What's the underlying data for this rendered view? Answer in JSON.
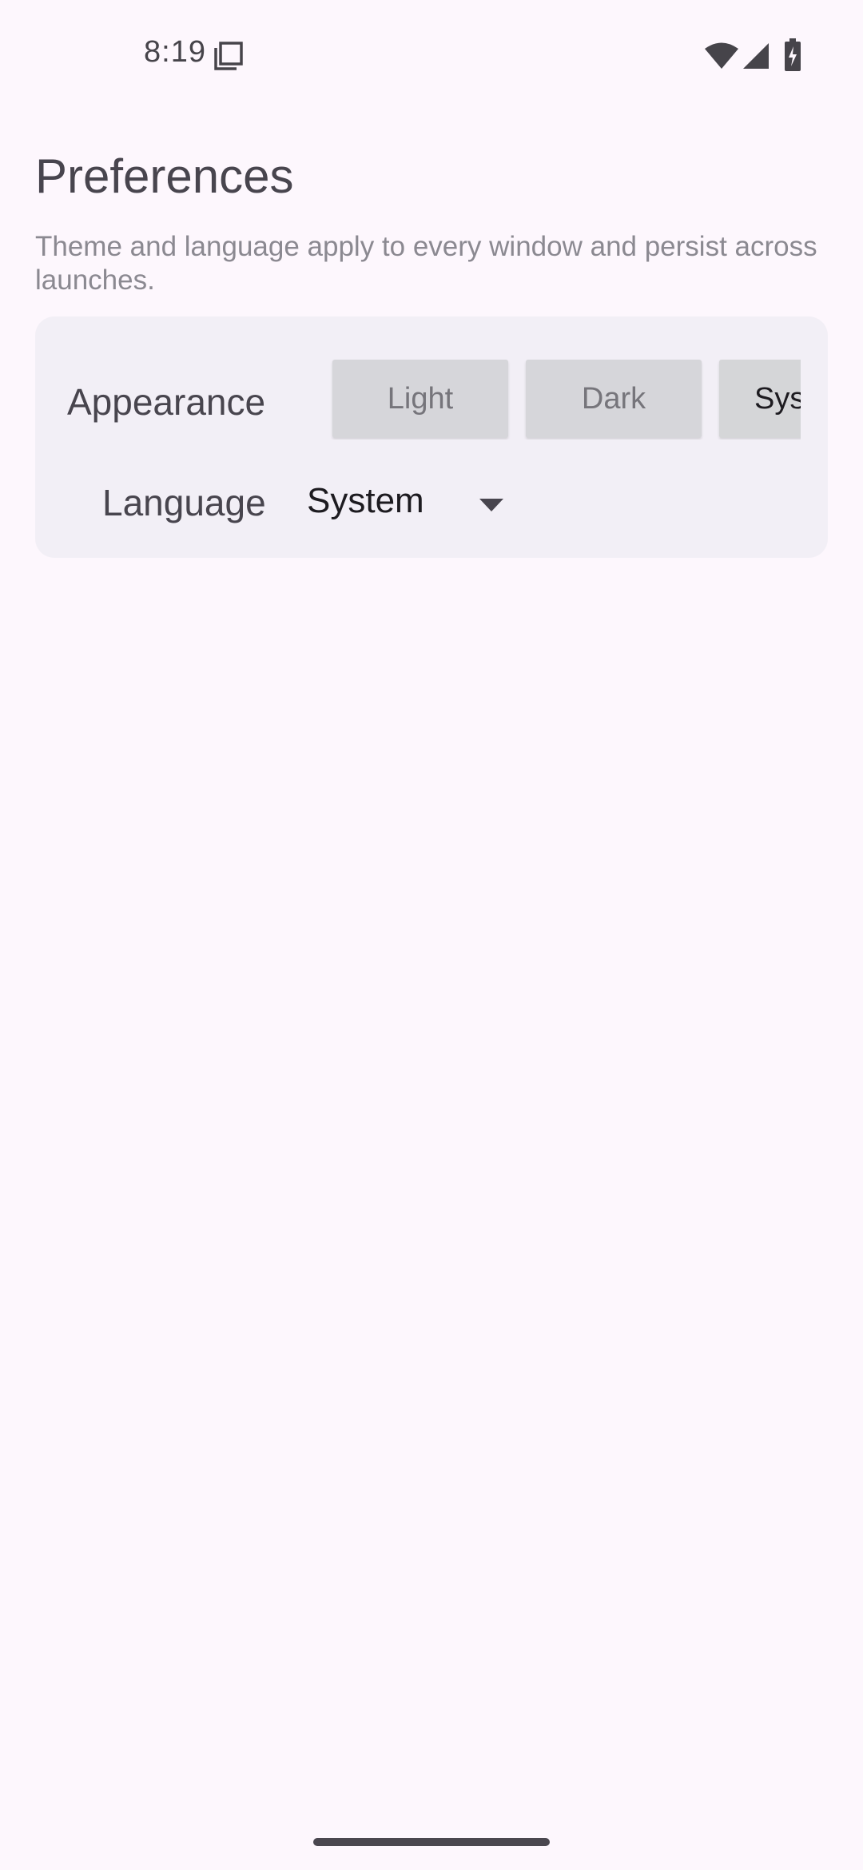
{
  "status_bar": {
    "time": "8:19",
    "icons": [
      "notification-icon",
      "wifi-icon",
      "signal-icon",
      "battery-charging-icon"
    ]
  },
  "header": {
    "title": "Preferences",
    "subtitle": "Theme and language apply to every window and persist across launches."
  },
  "appearance": {
    "label": "Appearance",
    "options": [
      "Light",
      "Dark",
      "Syste"
    ],
    "selected": "Syste"
  },
  "language": {
    "label": "Language",
    "value": "System"
  },
  "colors": {
    "background": "#fdf7fd",
    "card": "#f2eff6",
    "segment": "#d6d6da",
    "text_primary": "#1d1b20",
    "text_secondary": "#48454e"
  }
}
